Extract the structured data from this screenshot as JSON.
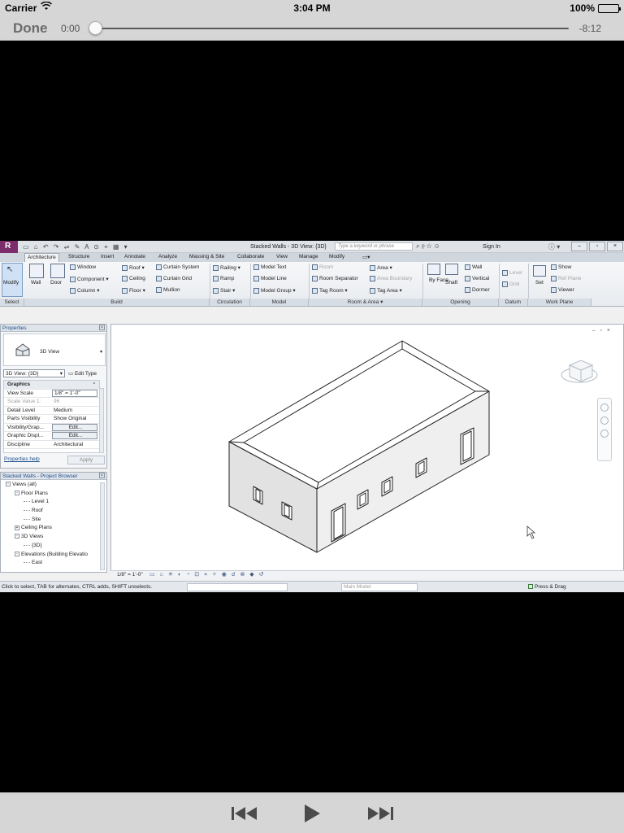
{
  "status": {
    "carrier": "Carrier",
    "time": "3:04 PM",
    "battery": "100%"
  },
  "player": {
    "done_label": "Done",
    "elapsed": "0:00",
    "remaining": "-8:12",
    "progress": 0.0
  },
  "revit": {
    "title": {
      "document": "Stacked Walls - 3D View: {3D}",
      "search_placeholder": "Type a keyword or phrase",
      "sign_in": "Sign In"
    },
    "tabs": [
      "Architecture",
      "Structure",
      "Insert",
      "Annotate",
      "Analyze",
      "Massing & Site",
      "Collaborate",
      "View",
      "Manage",
      "Modify"
    ],
    "ribbon": {
      "select": {
        "modify": "Modify",
        "group": "Select"
      },
      "build": {
        "wall": "Wall",
        "door": "Door",
        "window": "Window",
        "component": "Component",
        "column": "Column",
        "roof": "Roof",
        "ceiling": "Ceiling",
        "floor": "Floor",
        "curtain_system": "Curtain System",
        "curtain_grid": "Curtain Grid",
        "mullion": "Mullion",
        "group": "Build"
      },
      "circulation": {
        "railing": "Railing",
        "ramp": "Ramp",
        "stair": "Stair",
        "group": "Circulation"
      },
      "model": {
        "model_text": "Model Text",
        "model_line": "Model Line",
        "model_group": "Model Group",
        "group": "Model"
      },
      "room_area": {
        "room": "Room",
        "room_separator": "Room Separator",
        "tag_room": "Tag Room",
        "area": "Area",
        "area_boundary": "Area Boundary",
        "tag_area": "Tag Area",
        "group": "Room & Area"
      },
      "opening": {
        "by_face": "By Face",
        "shaft": "Shaft",
        "wall": "Wall",
        "vertical": "Vertical",
        "dormer": "Dormer",
        "group": "Opening"
      },
      "datum": {
        "level": "Level",
        "grid": "Grid",
        "group": "Datum"
      },
      "work_plane": {
        "set": "Set",
        "show": "Show",
        "ref_plane": "Ref Plane",
        "viewer": "Viewer",
        "group": "Work Plane"
      }
    },
    "properties": {
      "title": "Properties",
      "type_name": "3D View",
      "selector": "3D View: {3D}",
      "edit_type": "Edit Type",
      "rows": [
        {
          "key": "Graphics",
          "value": "",
          "kind": "group"
        },
        {
          "key": "View Scale",
          "value": "1/8\" = 1'-0\"",
          "kind": "boxed"
        },
        {
          "key": "Scale Value    1:",
          "value": "96",
          "kind": "dim"
        },
        {
          "key": "Detail Level",
          "value": "Medium",
          "kind": "plain"
        },
        {
          "key": "Parts Visibility",
          "value": "Show Original",
          "kind": "plain"
        },
        {
          "key": "Visibility/Grap...",
          "value": "Edit...",
          "kind": "btn"
        },
        {
          "key": "Graphic Displ...",
          "value": "Edit...",
          "kind": "btn"
        },
        {
          "key": "Discipline",
          "value": "Architectural",
          "kind": "plain"
        }
      ],
      "help_link": "Properties help",
      "apply": "Apply"
    },
    "browser": {
      "title": "Stacked Walls - Project Browser",
      "nodes": [
        {
          "label": "Views (all)",
          "depth": 0,
          "toggle": "-"
        },
        {
          "label": "Floor Plans",
          "depth": 1,
          "toggle": "-"
        },
        {
          "label": "Level 1",
          "depth": 2,
          "toggle": ""
        },
        {
          "label": "Roof",
          "depth": 2,
          "toggle": ""
        },
        {
          "label": "Site",
          "depth": 2,
          "toggle": ""
        },
        {
          "label": "Ceiling Plans",
          "depth": 1,
          "toggle": "+"
        },
        {
          "label": "3D Views",
          "depth": 1,
          "toggle": "-"
        },
        {
          "label": "{3D}",
          "depth": 2,
          "toggle": ""
        },
        {
          "label": "Elevations (Building Elevatio",
          "depth": 1,
          "toggle": "-"
        },
        {
          "label": "East",
          "depth": 2,
          "toggle": ""
        }
      ]
    },
    "view_control": {
      "scale": "1/8\" = 1'-0\""
    },
    "statusbar": {
      "message": "Click to select, TAB for alternates, CTRL adds, SHIFT unselects.",
      "workset": "Main Model",
      "press_drag": "Press & Drag"
    }
  }
}
